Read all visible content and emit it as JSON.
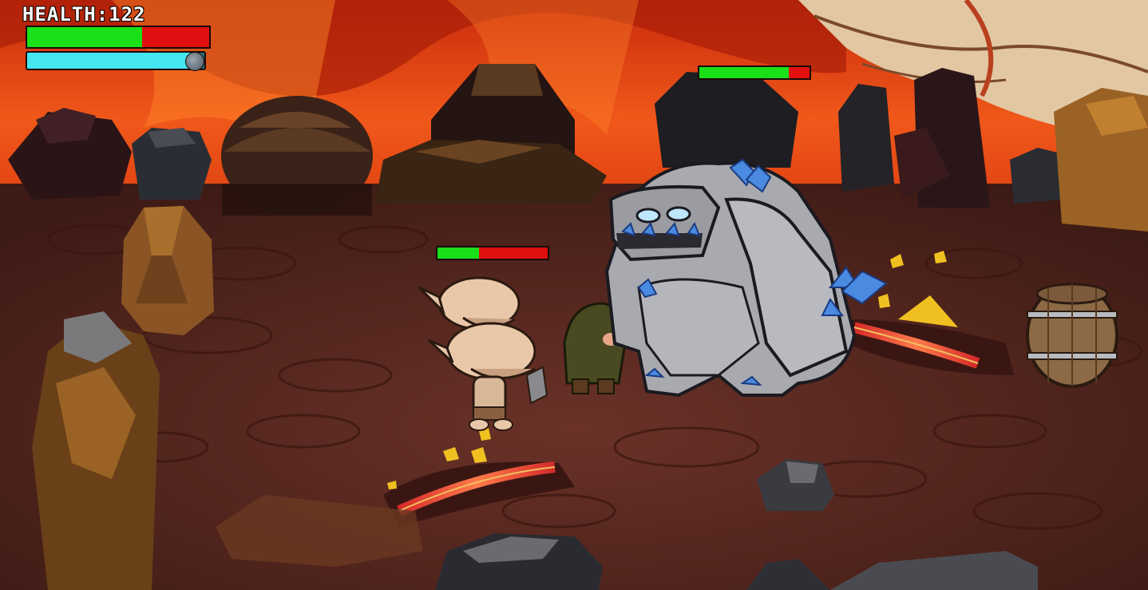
{
  "hud": {
    "health_label": "HEALTH:",
    "health_value": "122",
    "player_health_fraction": 0.63,
    "player_mana_fraction": 0.96,
    "health_color": "#19e019",
    "damage_color": "#e01010",
    "mana_color": "#45e6f0"
  },
  "enemies": [
    {
      "kind": "stone-golem",
      "health_fraction": 0.81
    },
    {
      "kind": "goblin-pair",
      "health_fraction": 0.38
    }
  ],
  "scene": {
    "setting": "volcanic-cave",
    "lava_color": "#e8521c",
    "ground_color": "#5a2a22"
  }
}
